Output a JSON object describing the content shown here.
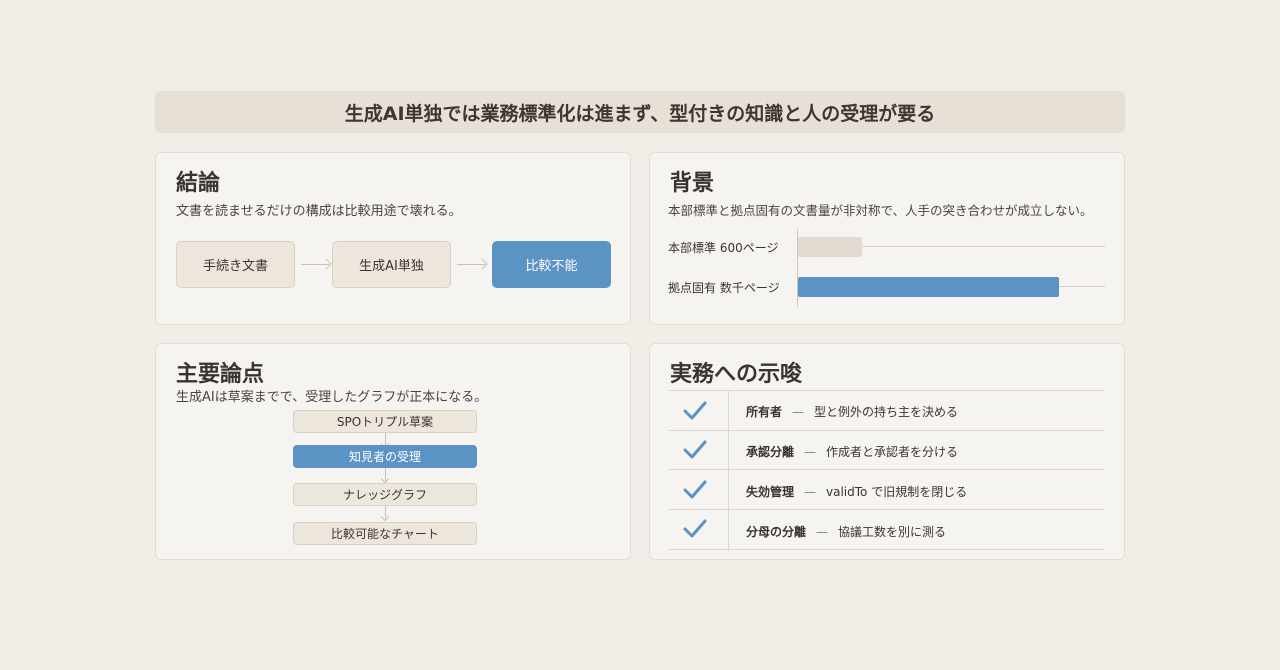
{
  "banner": {
    "title": "生成AI単独では業務標準化は進まず、型付きの知識と人の受理が要る"
  },
  "conclusion": {
    "title": "結論",
    "subtitle": "文書を読ませるだけの構成は比較用途で壊れる。",
    "flow": [
      "手続き文書",
      "生成AI単独",
      "比較不能"
    ]
  },
  "background": {
    "title": "背景",
    "subtitle": "本部標準と拠点固有の文書量が非対称で、人手の突き合わせが成立しない。",
    "chart_data": {
      "type": "bar",
      "orientation": "horizontal",
      "categories": [
        "本部標準 600ページ",
        "拠点固有 数千ページ"
      ],
      "values": [
        0.21,
        0.85
      ],
      "value_note": "relative length only; no numeric axis shown",
      "colors": [
        "#e2dad0",
        "#5b93c4"
      ]
    }
  },
  "points": {
    "title": "主要論点",
    "subtitle": "生成AIは草案までで、受理したグラフが正本になる。",
    "steps": [
      "SPOトリプル草案",
      "知見者の受理",
      "ナレッジグラフ",
      "比較可能なチャート"
    ]
  },
  "implications": {
    "title": "実務への示唆",
    "dash": "—",
    "rows": [
      {
        "key": "所有者",
        "text": "型と例外の持ち主を決める"
      },
      {
        "key": "承認分離",
        "text": "作成者と承認者を分ける"
      },
      {
        "key": "失効管理",
        "text": "validTo で旧規制を閉じる"
      },
      {
        "key": "分母の分離",
        "text": "協議工数を別に測る"
      }
    ]
  },
  "colors": {
    "accent": "#5b93c4",
    "card": "#f6f4f0",
    "background": "#f1eee8"
  },
  "icons": {
    "check": "check-icon"
  }
}
